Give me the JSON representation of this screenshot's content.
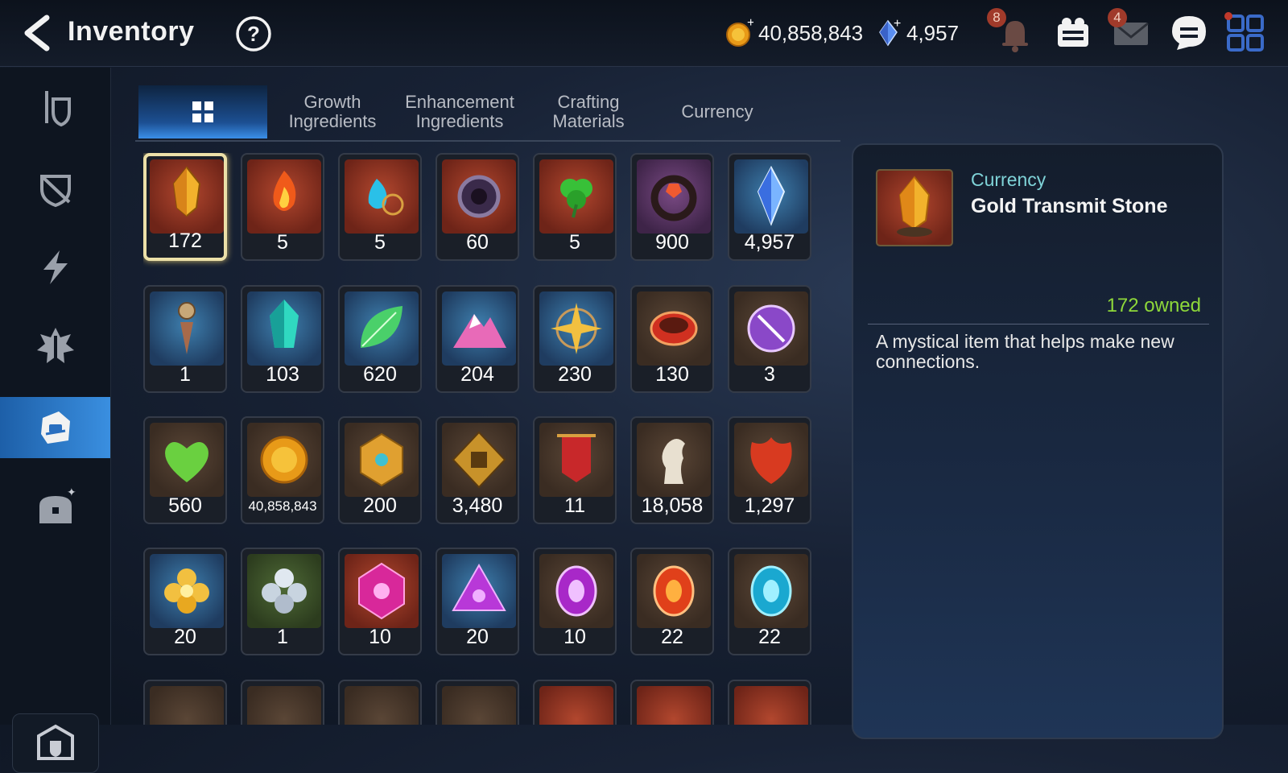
{
  "header": {
    "title": "Inventory",
    "gold": "40,858,843",
    "crystals": "4,957",
    "notification_count": "8",
    "mail_count": "4"
  },
  "tabs": [
    {
      "label": "",
      "icon": "grid-icon",
      "active": true
    },
    {
      "label": "Growth\nIngredients"
    },
    {
      "label": "Enhancement\nIngredients"
    },
    {
      "label": "Crafting\nMaterials"
    },
    {
      "label": "Currency"
    }
  ],
  "sidenav": [
    "gear-icon",
    "shield-icon",
    "lightning-icon",
    "sword-emblem-icon",
    "bag-icon",
    "chest-icon",
    "storage-icon"
  ],
  "items": [
    {
      "qty": "172",
      "icon": "gold-stone",
      "bg": "red"
    },
    {
      "qty": "5",
      "icon": "fire-rune",
      "bg": "red"
    },
    {
      "qty": "5",
      "icon": "water-rune",
      "bg": "red"
    },
    {
      "qty": "60",
      "icon": "dark-ring",
      "bg": "red"
    },
    {
      "qty": "5",
      "icon": "clover-rune",
      "bg": "red"
    },
    {
      "qty": "900",
      "icon": "ring-gem",
      "bg": "purple"
    },
    {
      "qty": "4,957",
      "icon": "blue-crystal",
      "bg": "blue"
    },
    {
      "qty": "1",
      "icon": "pendulum",
      "bg": "blue"
    },
    {
      "qty": "103",
      "icon": "teal-crystal",
      "bg": "blue"
    },
    {
      "qty": "620",
      "icon": "leaf",
      "bg": "blue"
    },
    {
      "qty": "204",
      "icon": "pink-mountain",
      "bg": "blue"
    },
    {
      "qty": "230",
      "icon": "star-compass",
      "bg": "blue"
    },
    {
      "qty": "130",
      "icon": "red-bracelet",
      "bg": "brown"
    },
    {
      "qty": "3",
      "icon": "purple-seal",
      "bg": "brown"
    },
    {
      "qty": "560",
      "icon": "green-heart",
      "bg": "brown"
    },
    {
      "qty": "40,858,843",
      "icon": "gold-coin",
      "bg": "brown"
    },
    {
      "qty": "200",
      "icon": "gold-emblem",
      "bg": "brown"
    },
    {
      "qty": "3,480",
      "icon": "fist-crest",
      "bg": "brown"
    },
    {
      "qty": "11",
      "icon": "red-banner",
      "bg": "brown"
    },
    {
      "qty": "18,058",
      "icon": "silver-horse",
      "bg": "brown"
    },
    {
      "qty": "1,297",
      "icon": "red-leaf",
      "bg": "brown"
    },
    {
      "qty": "20",
      "icon": "gold-flower",
      "bg": "blue"
    },
    {
      "qty": "1",
      "icon": "silver-flower",
      "bg": "green"
    },
    {
      "qty": "10",
      "icon": "pink-gem-hex",
      "bg": "red"
    },
    {
      "qty": "20",
      "icon": "purple-triangle-gem",
      "bg": "blue"
    },
    {
      "qty": "10",
      "icon": "purple-oval-gem",
      "bg": "brown"
    },
    {
      "qty": "22",
      "icon": "orange-oval-gem",
      "bg": "brown"
    },
    {
      "qty": "22",
      "icon": "cyan-oval-gem",
      "bg": "brown"
    }
  ],
  "detail": {
    "category": "Currency",
    "name": "Gold Transmit Stone",
    "owned": "172 owned",
    "description": "A mystical item that helps make new connections."
  },
  "colors": {
    "accent": "#3a8fe0",
    "owned": "#8ed83a",
    "category": "#7fd3d8",
    "selected_border": "#ece0a8"
  }
}
